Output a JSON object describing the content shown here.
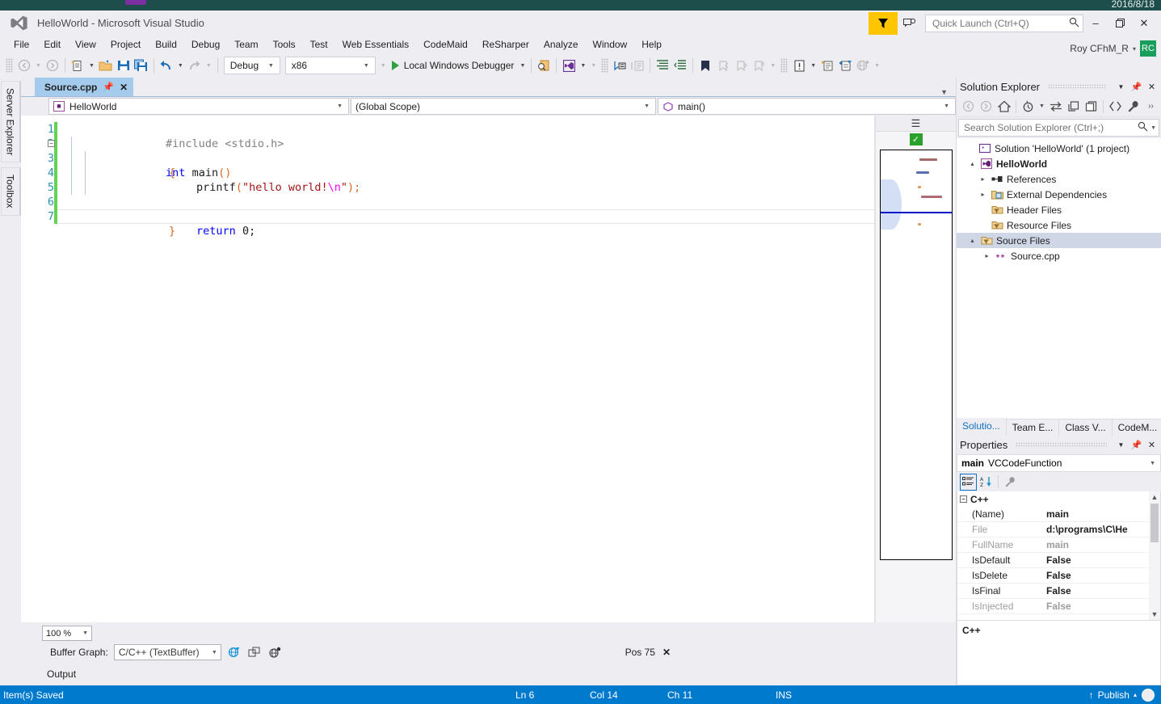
{
  "desktop": {
    "date": "2016/8/18"
  },
  "titlebar": {
    "title": "HelloWorld - Microsoft Visual Studio",
    "logo_icon": "visual-studio-logo",
    "filter_icon": "filter-icon",
    "feedback_icon": "feedback-smiley-icon",
    "quick_launch_placeholder": "Quick Launch (Ctrl+Q)",
    "quick_launch_value": "",
    "search_icon": "search-magnifier-icon",
    "minimize": "–",
    "restore": "❐",
    "close": "✕",
    "user_name": "Roy CFhM_R",
    "user_caret": "▾",
    "avatar_initials": "RC"
  },
  "menubar": {
    "items": [
      "File",
      "Edit",
      "View",
      "Project",
      "Build",
      "Debug",
      "Team",
      "Tools",
      "Test",
      "Web Essentials",
      "CodeMaid",
      "ReSharper",
      "Analyze",
      "Window",
      "Help"
    ]
  },
  "toolbar": {
    "nav_back_icon": "navigate-back-icon",
    "nav_forward_icon": "navigate-forward-icon",
    "new_item_icon": "new-item-icon",
    "open_file_icon": "open-file-folder-icon",
    "save_icon": "save-icon",
    "save_all_icon": "save-all-icon",
    "undo_icon": "undo-arrow-icon",
    "redo_icon": "redo-arrow-icon",
    "config_value": "Debug",
    "platform_value": "x86",
    "run_label": "Local Windows Debugger",
    "run_icon": "play-triangle-icon",
    "find_icon": "find-in-files-icon",
    "vs_ext_icon": "extension-icon",
    "step_icon": "step-into-icon",
    "comment_icon": "comment-block-icon",
    "indent_icon": "increase-indent-icon",
    "outdent_icon": "decrease-indent-icon",
    "bookmark_icon": "bookmark-icon",
    "bm_prev_icon": "previous-bookmark-icon",
    "bm_next_icon": "next-bookmark-icon",
    "bm_clear_icon": "clear-bookmarks-icon",
    "error_icon": "error-list-icon",
    "new_proj_icon": "new-project-icon",
    "add_item_icon": "add-new-item-icon",
    "browser_icon": "browser-icon"
  },
  "leftdock": {
    "tabs": [
      "Server Explorer",
      "Toolbox"
    ]
  },
  "editor": {
    "tab_label": "Source.cpp",
    "tab_pin_icon": "pin-icon",
    "tab_close_icon": "close-icon",
    "tab_chevron_icon": "chevron-down-icon",
    "nav_project": "HelloWorld",
    "nav_project_icon": "project-icon",
    "nav_scope": "(Global Scope)",
    "nav_member": "main()",
    "nav_member_icon": "method-icon",
    "line_numbers": [
      "1",
      "2",
      "3",
      "4",
      "5",
      "6",
      "7"
    ],
    "code": {
      "l1_directive": "#include <stdio.h>",
      "l2_kw": "int",
      "l2_fn": " main",
      "l2_par": "()",
      "l3_brace": "{",
      "l4_fn": "printf",
      "l4_open": "(",
      "l4_str": "\"hello world!",
      "l4_esc": "\\n",
      "l4_str_end": "\"",
      "l4_close": ");",
      "l6_kw": "return",
      "l6_num": " 0;",
      "l7_brace": "}"
    },
    "current_line": 6,
    "split_icon": "split-view-icon",
    "health_icon": "code-health-ok-icon",
    "zoom_level": "100 %",
    "buffer_graph_label": "Buffer Graph:",
    "buffer_graph_value": "C/C++ (TextBuffer)",
    "buffer_icon_1": "globe-buffer-icon",
    "buffer_icon_2": "projection-buffer-icon",
    "buffer_icon_3": "graph-buffer-icon",
    "pos_label": "Pos 75",
    "pos_close_icon": "close-icon",
    "output_tab": "Output"
  },
  "solution_explorer": {
    "title": "Solution Explorer",
    "back_icon": "back-arrow-icon",
    "forward_icon": "forward-arrow-icon",
    "home_icon": "home-icon",
    "pending_icon": "pending-changes-icon",
    "sync_icon": "sync-with-active-document-icon",
    "refresh_icon": "refresh-icon",
    "collapse_icon": "collapse-all-icon",
    "show_all_icon": "show-all-files-icon",
    "properties_icon": "properties-wrench-icon",
    "overflow_icon": "toolbar-overflow-icon",
    "dropdown_icon": "chevron-down-icon",
    "pin_icon": "pin-icon",
    "close_icon": "close-icon",
    "search_placeholder": "Search Solution Explorer (Ctrl+;)",
    "search_value": "",
    "search_icon": "search-magnifier-icon",
    "search_caret_icon": "chevron-down-icon",
    "tree": [
      {
        "label": "Solution 'HelloWorld' (1 project)",
        "icon": "solution-icon",
        "indent": 0,
        "expander": "",
        "bold": false,
        "selected": false
      },
      {
        "label": "HelloWorld",
        "icon": "project-icon",
        "indent": 1,
        "expander": "▴",
        "bold": true,
        "selected": false
      },
      {
        "label": "References",
        "icon": "references-icon",
        "indent": 2,
        "expander": "▸",
        "bold": false,
        "selected": false
      },
      {
        "label": "External Dependencies",
        "icon": "external-dependencies-folder-icon",
        "indent": 2,
        "expander": "▸",
        "bold": false,
        "selected": false
      },
      {
        "label": "Header Files",
        "icon": "filter-folder-icon",
        "indent": 2,
        "expander": "",
        "bold": false,
        "selected": false
      },
      {
        "label": "Resource Files",
        "icon": "filter-folder-icon",
        "indent": 2,
        "expander": "",
        "bold": false,
        "selected": false
      },
      {
        "label": "Source Files",
        "icon": "filter-folder-open-icon",
        "indent": 2,
        "expander": "▴",
        "bold": false,
        "selected": true
      },
      {
        "label": "Source.cpp",
        "icon": "cpp-file-icon",
        "indent": 3,
        "expander": "▸",
        "bold": false,
        "selected": false
      }
    ],
    "dock_tabs": [
      {
        "label": "Solutio...",
        "active": true
      },
      {
        "label": "Team E...",
        "active": false
      },
      {
        "label": "Class V...",
        "active": false
      },
      {
        "label": "CodeM...",
        "active": false
      }
    ]
  },
  "properties": {
    "title": "Properties",
    "dropdown_icon": "chevron-down-icon",
    "pin_icon": "pin-icon",
    "close_icon": "close-icon",
    "object_name": "main",
    "object_type": "VCCodeFunction",
    "object_caret": "▾",
    "categorized_icon": "categorized-view-icon",
    "alphabetical_icon": "alphabetical-sort-icon",
    "property_pages_icon": "property-pages-wrench-icon",
    "category": "C++",
    "rows": [
      {
        "name": "(Name)",
        "value": "main",
        "name_dim": false,
        "value_dim": false
      },
      {
        "name": "File",
        "value": "d:\\programs\\C\\He",
        "name_dim": true,
        "value_dim": false
      },
      {
        "name": "FullName",
        "value": "main",
        "name_dim": true,
        "value_dim": true
      },
      {
        "name": "IsDefault",
        "value": "False",
        "name_dim": false,
        "value_dim": false
      },
      {
        "name": "IsDelete",
        "value": "False",
        "name_dim": false,
        "value_dim": false
      },
      {
        "name": "IsFinal",
        "value": "False",
        "name_dim": false,
        "value_dim": false
      },
      {
        "name": "IsInjected",
        "value": "False",
        "name_dim": true,
        "value_dim": true
      }
    ],
    "scroll_up_icon": "scroll-up-arrow-icon",
    "scroll_down_icon": "scroll-down-arrow-icon",
    "description": "C++"
  },
  "statusbar": {
    "message": "Item(s) Saved",
    "line": "Ln 6",
    "column": "Col 14",
    "character": "Ch 11",
    "insert_mode": "INS",
    "publish_label": "Publish",
    "publish_icon": "publish-up-arrow-icon",
    "publish_caret": "▴",
    "notification_icon": "notification-circle-icon"
  },
  "colors": {
    "accent": "#007acc",
    "titlebar_bg": "#eeeef2",
    "active_tab": "#a5cbec",
    "desktop": "#1d4e4b",
    "filter_yellow": "#ffc600",
    "avatar_green": "#1a9e5b",
    "change_bar_green": "#62d353",
    "keyword_blue": "#0000ff",
    "string_red": "#a31515",
    "escape_magenta": "#ff00ff",
    "paren_orange": "#d2691e",
    "linenum_teal": "#2b91af",
    "comment_gray": "#808080"
  }
}
